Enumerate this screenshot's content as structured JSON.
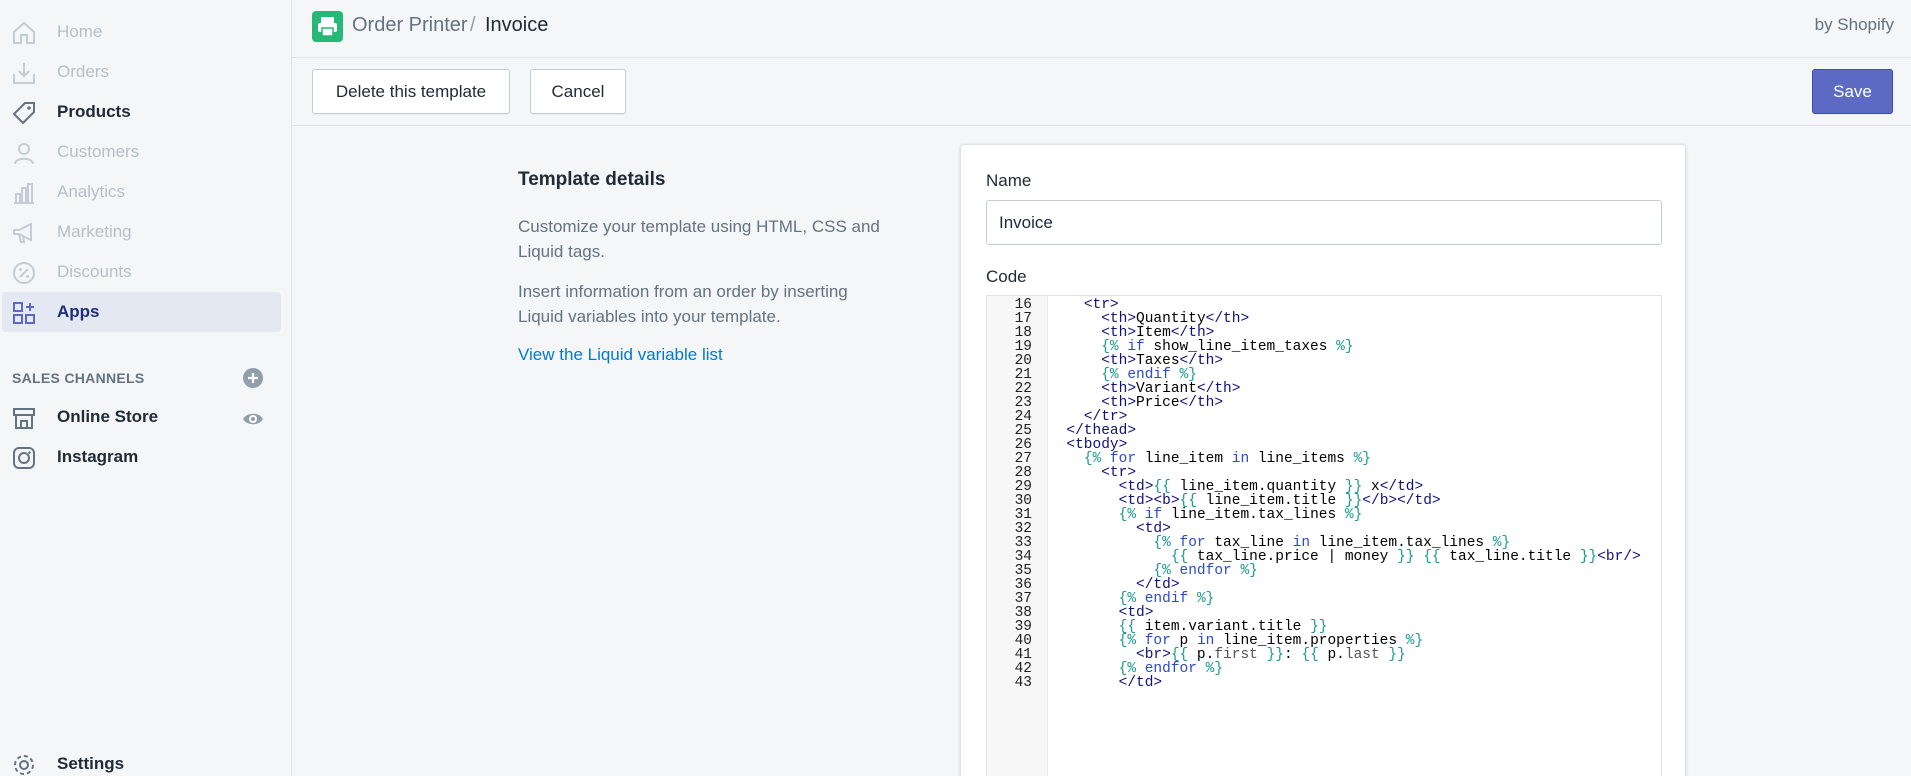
{
  "sidebar": {
    "items": [
      {
        "label": "Home",
        "icon": "home-icon"
      },
      {
        "label": "Orders",
        "icon": "orders-icon"
      },
      {
        "label": "Products",
        "icon": "tag-icon"
      },
      {
        "label": "Customers",
        "icon": "person-icon"
      },
      {
        "label": "Analytics",
        "icon": "bar-chart-icon"
      },
      {
        "label": "Marketing",
        "icon": "megaphone-icon"
      },
      {
        "label": "Discounts",
        "icon": "discount-icon"
      },
      {
        "label": "Apps",
        "icon": "apps-icon"
      }
    ],
    "sales_channels_heading": "SALES CHANNELS",
    "channels": [
      {
        "label": "Online Store",
        "icon": "store-icon"
      },
      {
        "label": "Instagram",
        "icon": "instagram-icon"
      }
    ],
    "settings_label": "Settings"
  },
  "topbar": {
    "app_name": "Order Printer",
    "separator": "/",
    "page": "Invoice",
    "by_shopify": "by Shopify"
  },
  "actions": {
    "delete": "Delete this template",
    "cancel": "Cancel",
    "save": "Save"
  },
  "info": {
    "title": "Template details",
    "p1": "Customize your template using HTML, CSS and Liquid tags.",
    "p2": "Insert information from an order by inserting Liquid variables into your template.",
    "link": "View the Liquid variable list"
  },
  "form": {
    "name_label": "Name",
    "name_value": "Invoice",
    "code_label": "Code"
  },
  "code_lines": [
    {
      "n": "16",
      "text": "    <tr>"
    },
    {
      "n": "17",
      "text": "      <th>Quantity</th>"
    },
    {
      "n": "18",
      "text": "      <th>Item</th>"
    },
    {
      "n": "19",
      "text": "      {% if show_line_item_taxes %}"
    },
    {
      "n": "20",
      "text": "      <th>Taxes</th>"
    },
    {
      "n": "21",
      "text": "      {% endif %}"
    },
    {
      "n": "22",
      "text": "      <th>Variant</th>"
    },
    {
      "n": "23",
      "text": "      <th>Price</th>"
    },
    {
      "n": "24",
      "text": "    </tr>"
    },
    {
      "n": "25",
      "text": "  </thead>"
    },
    {
      "n": "26",
      "text": "  <tbody>"
    },
    {
      "n": "27",
      "text": "    {% for line_item in line_items %}"
    },
    {
      "n": "28",
      "text": "      <tr>"
    },
    {
      "n": "29",
      "text": "        <td>{{ line_item.quantity }} x</td>"
    },
    {
      "n": "30",
      "text": "        <td><b>{{ line_item.title }}</b></td>"
    },
    {
      "n": "31",
      "text": "        {% if line_item.tax_lines %}"
    },
    {
      "n": "32",
      "text": "          <td>"
    },
    {
      "n": "33",
      "text": "            {% for tax_line in line_item.tax_lines %}"
    },
    {
      "n": "34",
      "text": "              {{ tax_line.price | money }} {{ tax_line.title }}<br/>"
    },
    {
      "n": "35",
      "text": "            {% endfor %}"
    },
    {
      "n": "36",
      "text": "          </td>"
    },
    {
      "n": "37",
      "text": "        {% endif %}"
    },
    {
      "n": "38",
      "text": "        <td>"
    },
    {
      "n": "39",
      "text": "        {{ item.variant.title }}"
    },
    {
      "n": "40",
      "text": "        {% for p in line_item.properties %}"
    },
    {
      "n": "41",
      "text": "          <br>{{ p.first }}: {{ p.last }}"
    },
    {
      "n": "42",
      "text": "        {% endfor %}"
    },
    {
      "n": "43",
      "text": "        </td>"
    }
  ],
  "colors": {
    "accent": "#5c6ac4",
    "app_icon": "#27b776",
    "link": "#007ace",
    "active_nav_bg": "#e3e8f3",
    "active_nav_text": "#202e78"
  }
}
